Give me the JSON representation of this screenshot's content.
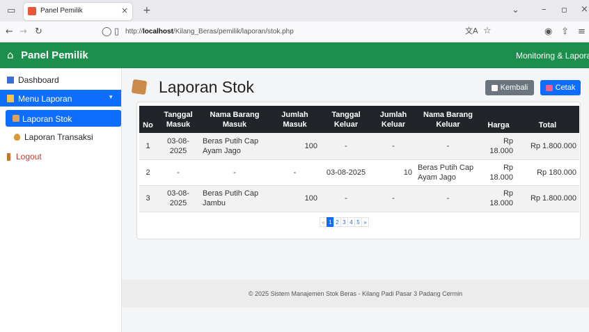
{
  "browser": {
    "tab_title": "Panel Pemilik",
    "url_prefix": "http://",
    "url_host": "localhost",
    "url_path": "/Kilang_Beras/pemilik/laporan/stok.php"
  },
  "header": {
    "brand": "Panel Pemilik",
    "right": "Monitoring & Laporan"
  },
  "sidebar": {
    "items": [
      {
        "label": "Dashboard"
      },
      {
        "label": "Menu Laporan"
      },
      {
        "label": "Laporan Stok"
      },
      {
        "label": "Laporan Transaksi"
      },
      {
        "label": "Logout"
      }
    ]
  },
  "page": {
    "title": "Laporan Stok",
    "back_label": "Kembali",
    "print_label": "Cetak"
  },
  "table": {
    "headers": [
      "No",
      "Tanggal Masuk",
      "Nama Barang Masuk",
      "Jumlah Masuk",
      "Tanggal Keluar",
      "Jumlah Keluar",
      "Nama Barang Keluar",
      "Harga",
      "Total"
    ],
    "rows": [
      [
        "1",
        "03-08-2025",
        "Beras Putih Cap Ayam Jago",
        "100",
        "-",
        "-",
        "-",
        "Rp 18.000",
        "Rp 1.800.000"
      ],
      [
        "2",
        "-",
        "-",
        "-",
        "03-08-2025",
        "10",
        "Beras Putih Cap Ayam Jago",
        "Rp 18.000",
        "Rp 180.000"
      ],
      [
        "3",
        "03-08-2025",
        "Beras Putih Cap Jambu",
        "100",
        "-",
        "-",
        "-",
        "Rp 18.000",
        "Rp 1.800.000"
      ]
    ]
  },
  "pagination": {
    "prev": "«",
    "pages": [
      "1",
      "2",
      "3",
      "4",
      "5"
    ],
    "next": "»",
    "active": "1"
  },
  "footer": "© 2025 Sistem Manajemen Stok Beras - Kilang Padi Pasar 3 Padang Cermin",
  "colors": {
    "header": "#1d8f4c",
    "sidebar_active": "#0d6efd",
    "back_button": "#6c757d",
    "print_button": "#0d6efd"
  }
}
